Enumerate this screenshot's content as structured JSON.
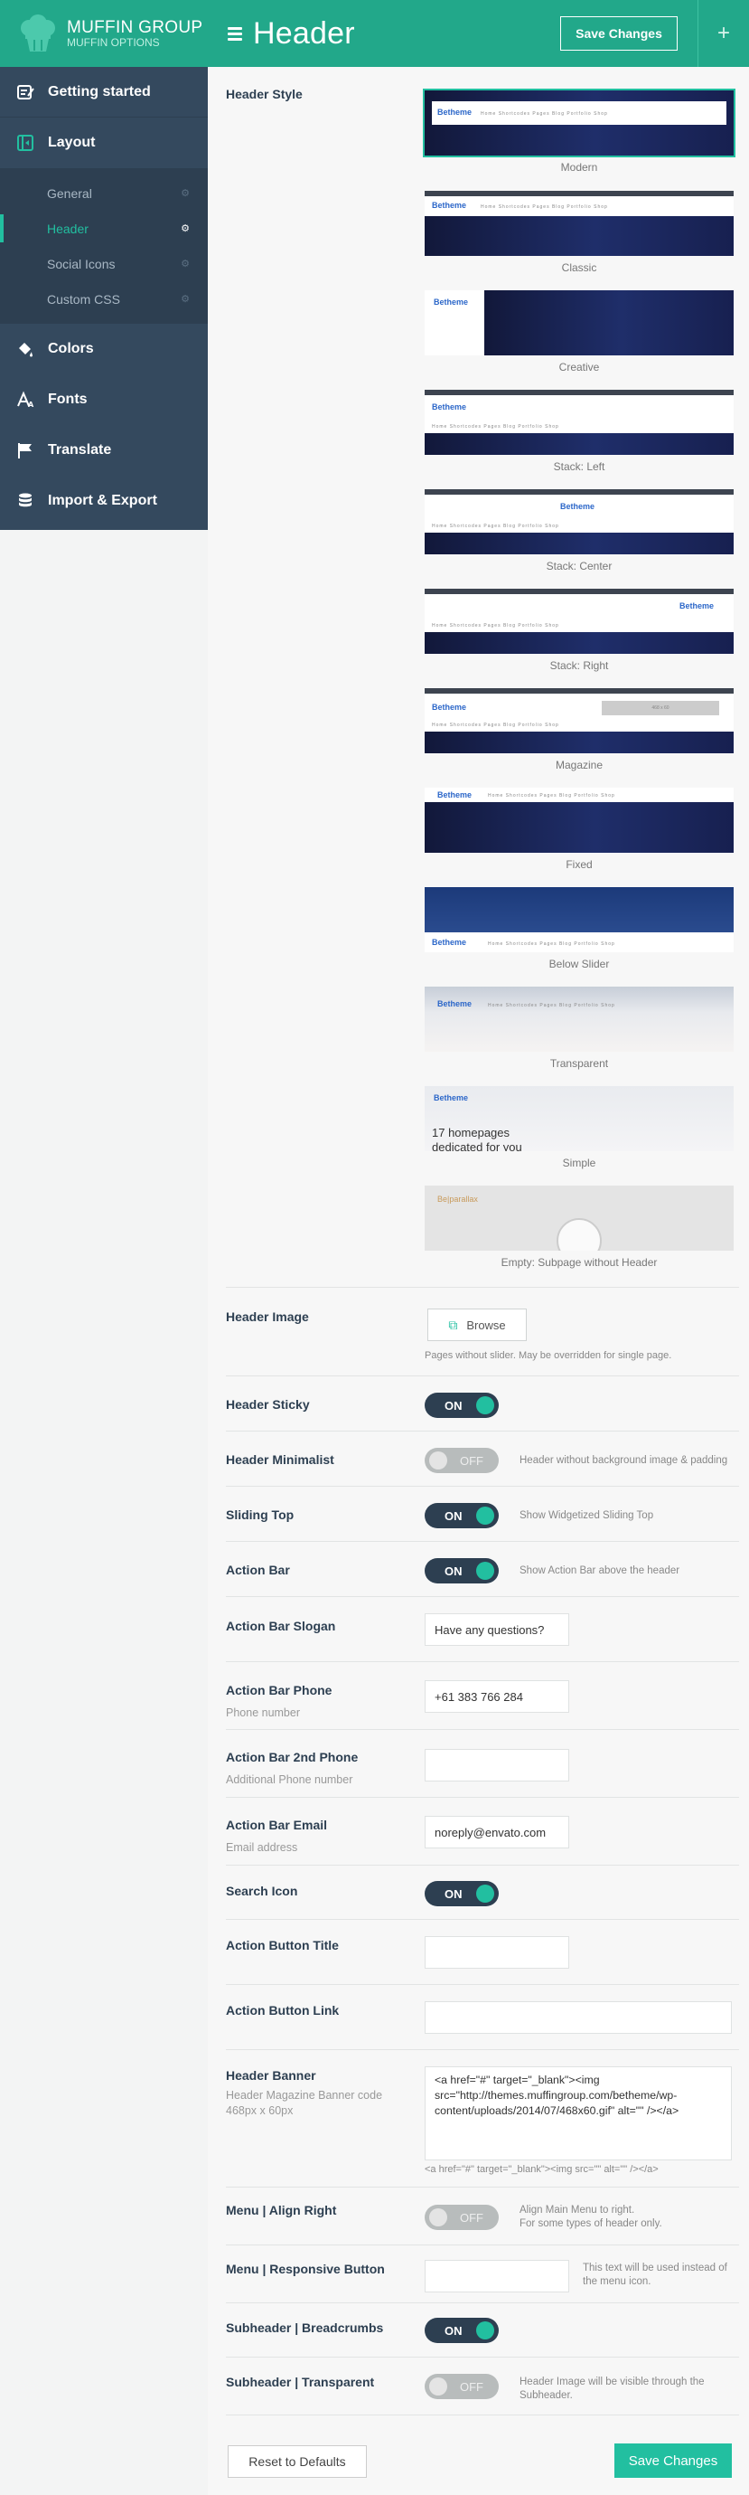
{
  "brand": {
    "title": "MUFFIN GROUP",
    "subtitle": "MUFFIN OPTIONS"
  },
  "header": {
    "title": "Header",
    "save_label": "Save Changes",
    "plus": "+"
  },
  "sidebar": {
    "main": [
      {
        "label": "Getting started",
        "icon": "edit-icon"
      },
      {
        "label": "Layout",
        "icon": "layout-icon"
      }
    ],
    "sub": [
      {
        "label": "General",
        "active": false
      },
      {
        "label": "Header",
        "active": true
      },
      {
        "label": "Social Icons",
        "active": false
      },
      {
        "label": "Custom CSS",
        "active": false
      }
    ],
    "lower": [
      {
        "label": "Colors",
        "icon": "paint-bucket-icon"
      },
      {
        "label": "Fonts",
        "icon": "font-icon"
      },
      {
        "label": "Translate",
        "icon": "flag-icon"
      },
      {
        "label": "Import & Export",
        "icon": "database-icon"
      }
    ]
  },
  "header_style": {
    "label": "Header Style",
    "selected": "Modern",
    "options": [
      "Modern",
      "Classic",
      "Creative",
      "Stack: Left",
      "Stack: Center",
      "Stack: Right",
      "Magazine",
      "Fixed",
      "Below Slider",
      "Transparent",
      "Simple",
      "Empty: Subpage without Header"
    ]
  },
  "thumb_text": {
    "logo": "Betheme",
    "logo2": "Be|parallax",
    "menu": "Home   Shortcodes   Pages   Blog   Portfolio   Shop",
    "hero": "17 homepages",
    "hero2": "dedicated for you",
    "banner": "468 x 60"
  },
  "header_image": {
    "label": "Header Image",
    "button": "Browse",
    "note": "Pages without slider. May be overridden for single page."
  },
  "header_sticky": {
    "label": "Header Sticky",
    "state": "ON"
  },
  "header_minimalist": {
    "label": "Header Minimalist",
    "state": "OFF",
    "hint": "Header without background image & padding"
  },
  "sliding_top": {
    "label": "Sliding Top",
    "state": "ON",
    "hint": "Show Widgetized Sliding Top"
  },
  "action_bar": {
    "label": "Action Bar",
    "state": "ON",
    "hint": "Show Action Bar above the header"
  },
  "action_bar_slogan": {
    "label": "Action Bar Slogan",
    "value": "Have any questions?"
  },
  "action_bar_phone": {
    "label": "Action Bar Phone",
    "desc": "Phone number",
    "value": "+61 383 766 284"
  },
  "action_bar_phone2": {
    "label": "Action Bar 2nd Phone",
    "desc": "Additional Phone number",
    "value": ""
  },
  "action_bar_email": {
    "label": "Action Bar Email",
    "desc": "Email address",
    "value": "noreply@envato.com"
  },
  "search_icon": {
    "label": "Search Icon",
    "state": "ON"
  },
  "action_button_title": {
    "label": "Action Button Title",
    "value": ""
  },
  "action_button_link": {
    "label": "Action Button Link",
    "value": ""
  },
  "header_banner": {
    "label": "Header Banner",
    "desc": "Header Magazine Banner code 468px x 60px",
    "value": "<a href=\"#\" target=\"_blank\"><img src=\"http://themes.muffingroup.com/betheme/wp-content/uploads/2014/07/468x60.gif\" alt=\"\" /></a>",
    "preview": "<a href=\"#\" target=\"_blank\"><img src=\"\" alt=\"\" /></a>"
  },
  "menu_align_right": {
    "label": "Menu | Align Right",
    "state": "OFF",
    "hint": "Align Main Menu to right.\nFor some types of header only."
  },
  "menu_responsive": {
    "label": "Menu | Responsive Button",
    "value": "",
    "hint": "This text will be used instead of the menu icon."
  },
  "subheader_breadcrumbs": {
    "label": "Subheader | Breadcrumbs",
    "state": "ON"
  },
  "subheader_transparent": {
    "label": "Subheader | Transparent",
    "state": "OFF",
    "hint": "Header Image will be visible through the Subheader."
  },
  "footer": {
    "reset_label": "Reset to Defaults",
    "save_label": "Save Changes"
  },
  "colors": {
    "accent": "#22bfa0",
    "topbar": "#22a88a",
    "sidebar": "#34495e"
  }
}
